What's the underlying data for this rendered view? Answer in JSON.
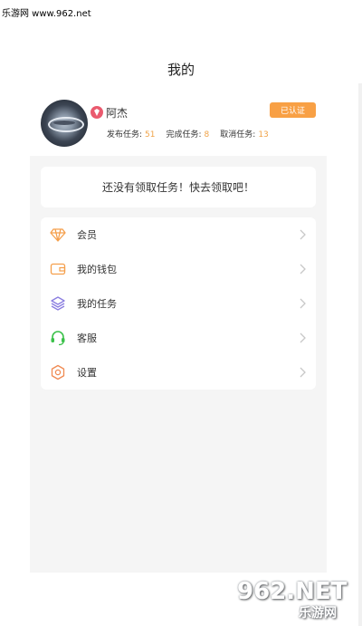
{
  "watermark_top": "乐游网 www.962.net",
  "header": {
    "title": "我的"
  },
  "profile": {
    "badge_icon": "gem-badge-icon",
    "username": "阿杰",
    "verified_label": "已认证",
    "stats": [
      {
        "label": "发布任务:",
        "value": "51"
      },
      {
        "label": "完成任务:",
        "value": "8"
      },
      {
        "label": "取消任务:",
        "value": "13"
      }
    ]
  },
  "notice": "还没有领取任务！快去领取吧！",
  "menu": [
    {
      "label": "会员",
      "icon": "diamond-icon",
      "color": "#f5a04d"
    },
    {
      "label": "我的钱包",
      "icon": "wallet-icon",
      "color": "#f5a04d"
    },
    {
      "label": "我的任务",
      "icon": "layers-icon",
      "color": "#8a7de0"
    },
    {
      "label": "客服",
      "icon": "headset-icon",
      "color": "#3bc14a"
    },
    {
      "label": "设置",
      "icon": "settings-icon",
      "color": "#f08a52"
    }
  ],
  "bottom_logo": {
    "big": "962.NET",
    "small": "乐游网"
  },
  "colors": {
    "accent": "#f8a045",
    "stat_value": "#f0a348",
    "panel_bg": "#f5f5f5"
  }
}
